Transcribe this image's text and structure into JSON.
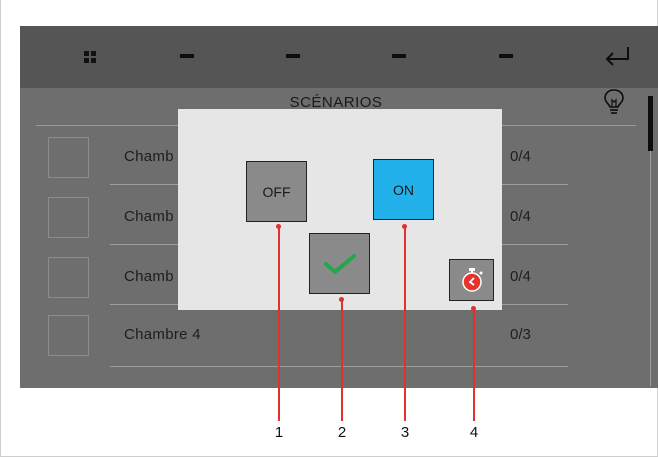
{
  "toolbar": {
    "grid_icon": "grid-icon",
    "back_icon": "return-arrow-icon"
  },
  "header": {
    "title": "SCÉNARIOS",
    "bulb_icon": "light-bulb-icon"
  },
  "rows": [
    {
      "label": "Chamb",
      "count": "0/4"
    },
    {
      "label": "Chamb",
      "count": "0/4"
    },
    {
      "label": "Chamb",
      "count": "0/4"
    },
    {
      "label": "Chambre 4",
      "count": "0/3"
    }
  ],
  "popup": {
    "off_label": "OFF",
    "on_label": "ON",
    "confirm_icon": "checkmark-icon",
    "timer_icon": "stopwatch-icon"
  },
  "callouts": [
    "1",
    "2",
    "3",
    "4"
  ],
  "colors": {
    "on_button": "#22b1ea",
    "callout": "#e03030",
    "checkmark": "#22a84a",
    "timer": "#e8322e"
  }
}
